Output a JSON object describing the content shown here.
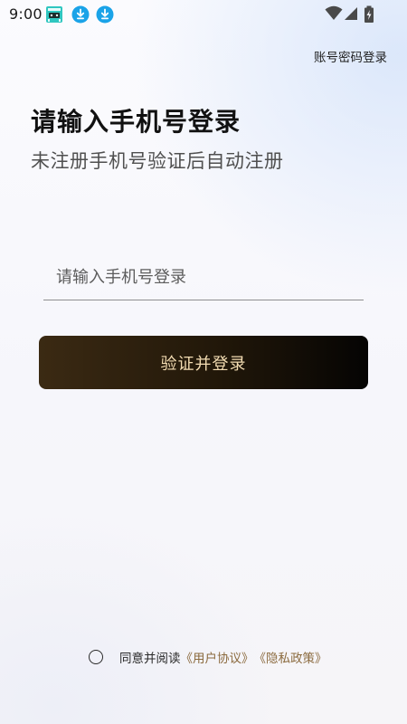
{
  "status_bar": {
    "time": "9:00",
    "app_icons": [
      "game-controller-icon",
      "download-icon",
      "download-icon"
    ],
    "indicators": [
      "wifi-icon",
      "signal-icon",
      "battery-charging-icon"
    ]
  },
  "header": {
    "account_login_label": "账号密码登录"
  },
  "main": {
    "title": "请输入手机号登录",
    "subtitle": "未注册手机号验证后自动注册",
    "phone_input": {
      "placeholder": "请输入手机号登录",
      "value": ""
    },
    "submit_label": "验证并登录"
  },
  "agreement": {
    "checked": false,
    "prefix": "同意并阅读",
    "user_agreement": "《用户协议》",
    "privacy_policy": "《隐私政策》"
  },
  "colors": {
    "button_gradient_start": "#3b2a13",
    "button_gradient_end": "#050403",
    "button_text": "#f3dcb2",
    "link": "#8b6a3e",
    "download_badge": "#1aa3e8",
    "app_icon": "#2fc6c0"
  }
}
